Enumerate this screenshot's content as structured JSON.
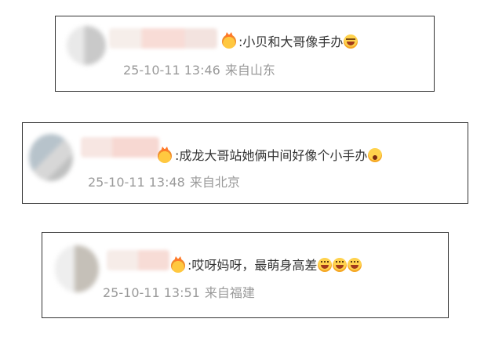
{
  "comments": [
    {
      "text": ":小贝和大哥像手办",
      "emojis": [
        "laughing-face-emoji"
      ],
      "time": "25-10-11 13:46",
      "location": "来自山东"
    },
    {
      "text": ":成龙大哥站她俩中间好像个小手办",
      "emojis": [
        "shocked-face-emoji"
      ],
      "time": "25-10-11 13:48",
      "location": "来自北京"
    },
    {
      "text": ":哎呀妈呀，最萌身高差",
      "emojis": [
        "grinning-face-emoji",
        "grinning-face-emoji",
        "grinning-face-emoji"
      ],
      "time": "25-10-11 13:51",
      "location": "来自福建"
    }
  ],
  "icons": {
    "vip_badge": "vip-crown-badge-icon",
    "avatar": "blurred-avatar"
  },
  "colors": {
    "comment_text": "#333333",
    "meta_text": "#9a9a9a",
    "border": "#333333"
  }
}
